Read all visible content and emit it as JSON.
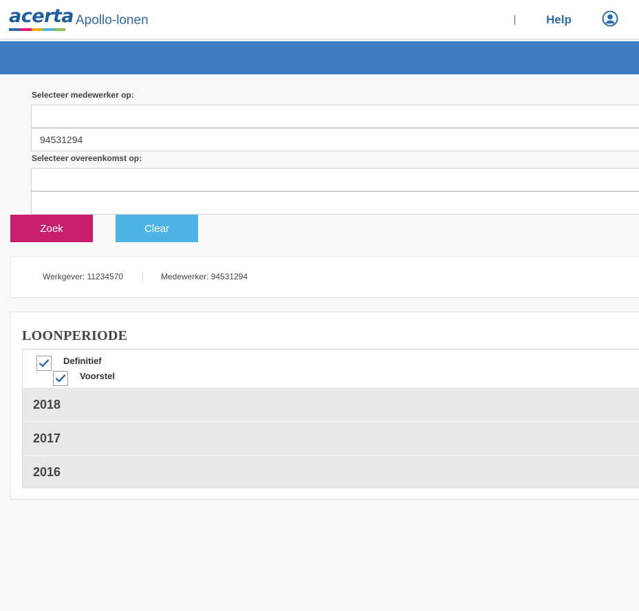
{
  "header": {
    "logo_text": "acerta",
    "logo_stripe_colors": [
      "#2e6aa8",
      "#e2137e",
      "#f2a900",
      "#52b5e8",
      "#8bc34a"
    ],
    "app_title": "Apollo-lonen",
    "separator": "|",
    "help_label": "Help",
    "user_icon": "user-circle-icon"
  },
  "colors": {
    "brand_blue": "#3d7cc1",
    "zoek_button": "#c81f6c",
    "clear_button": "#4eb3e6"
  },
  "search": {
    "employee_label": "Selecteer medewerker op:",
    "employee_field_1_value": "",
    "employee_field_2_value": "94531294",
    "agreement_label": "Selecteer overeenkomst op:",
    "agreement_field_1_value": "",
    "agreement_field_2_value": "",
    "zoek_label": "Zoek",
    "clear_label": "Clear"
  },
  "info": {
    "werkgever": "Werkgever: 11234570",
    "medewerker": "Medewerker: 94531294"
  },
  "loonperiode": {
    "title": "LOONPERIODE",
    "filters": [
      {
        "label": "Definitief",
        "checked": true
      },
      {
        "label": "Voorstel",
        "checked": true
      }
    ],
    "years": [
      "2018",
      "2017",
      "2016"
    ]
  }
}
